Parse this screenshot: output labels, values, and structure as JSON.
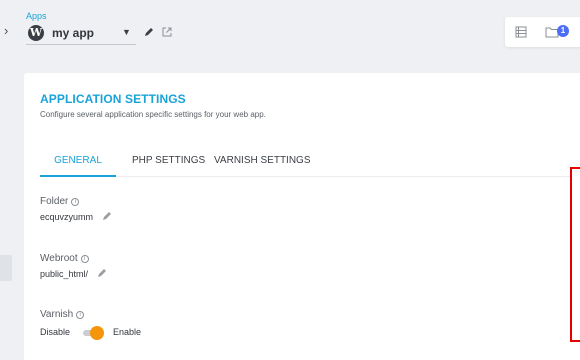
{
  "header": {
    "apps_label": "Apps",
    "app_name": "my app",
    "folder_badge_count": "1"
  },
  "settings": {
    "title": "APPLICATION SETTINGS",
    "subtitle": "Configure several application specific settings for your web app.",
    "tabs": [
      {
        "label": "GENERAL",
        "active": true
      },
      {
        "label": "PHP SETTINGS",
        "active": false
      },
      {
        "label": "VARNISH SETTINGS",
        "active": false
      }
    ],
    "folder": {
      "label": "Folder",
      "value": "ecquvzyumm"
    },
    "webroot": {
      "label": "Webroot",
      "value": "public_html/"
    },
    "varnish": {
      "label": "Varnish",
      "off_label": "Disable",
      "on_label": "Enable",
      "enabled": true
    }
  },
  "colors": {
    "accent": "#1aa3d9",
    "toggle": "#f5950c",
    "badge": "#4b6ef5",
    "highlight": "#e60000"
  }
}
